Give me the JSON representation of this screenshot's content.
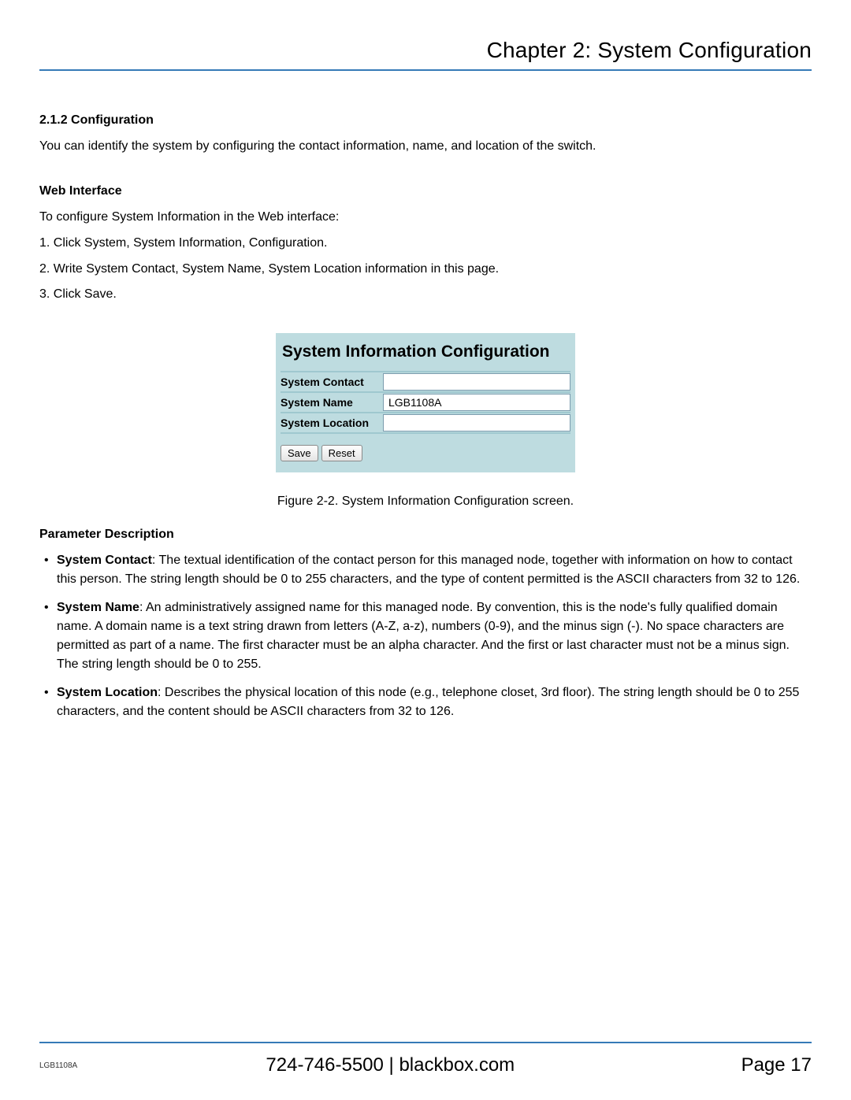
{
  "chapter_title": "Chapter 2: System Configuration",
  "section": {
    "number_title": "2.1.2 Configuration",
    "intro": "You can identify the system by configuring the contact information, name, and location of the switch."
  },
  "web_interface": {
    "heading": "Web Interface",
    "lead": "To configure System Information in the Web interface:",
    "steps": [
      "1. Click System, System Information, Configuration.",
      "2. Write System Contact, System Name, System Location information in this page.",
      "3. Click Save."
    ]
  },
  "figure": {
    "title": "System Information Configuration",
    "rows": {
      "0": {
        "label": "System Contact",
        "value": ""
      },
      "1": {
        "label": "System Name",
        "value": "LGB1108A"
      },
      "2": {
        "label": "System Location",
        "value": ""
      }
    },
    "buttons": {
      "save": "Save",
      "reset": "Reset"
    },
    "caption": "Figure 2-2. System Information Configuration screen."
  },
  "param_desc": {
    "heading": "Parameter Description",
    "items": {
      "0": {
        "name": "System Contact",
        "text": ": The textual identification of the contact person for this managed node, together with information on how to contact this person. The string length should be 0 to 255 characters, and the type of content permitted is the ASCII characters from 32 to 126."
      },
      "1": {
        "name": "System Name",
        "text": ": An administratively assigned name for this managed node. By convention, this is the node's fully qualified domain name. A domain name is a text string drawn from letters (A-Z, a-z), numbers (0-9), and the minus sign (-). No space characters are permitted as part of a name. The first character must be an alpha character. And the first or last character must not be a minus sign. The string length should be 0 to 255."
      },
      "2": {
        "name": "System Location",
        "text": ": Describes the physical location of this node (e.g., telephone closet, 3rd floor). The string length should be 0 to 255 characters, and the content should be ASCII characters from 32 to 126."
      }
    }
  },
  "footer": {
    "model": "LGB1108A",
    "center": "724-746-5500   |   blackbox.com",
    "page": "Page 17"
  }
}
